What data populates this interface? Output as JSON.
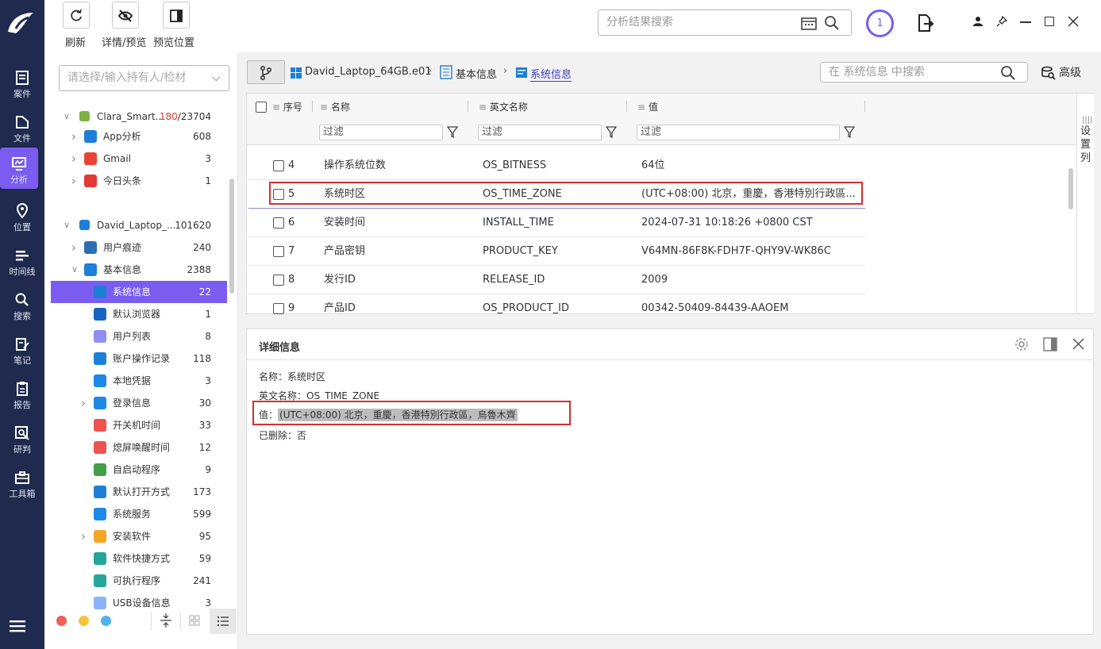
{
  "nav": [
    {
      "label": "案件",
      "icon": "case-icon"
    },
    {
      "label": "文件",
      "icon": "file-icon"
    },
    {
      "label": "分析",
      "icon": "analysis-icon"
    },
    {
      "label": "位置",
      "icon": "location-icon"
    },
    {
      "label": "时间线",
      "icon": "timeline-icon"
    },
    {
      "label": "搜索",
      "icon": "search-icon"
    },
    {
      "label": "笔记",
      "icon": "note-icon"
    },
    {
      "label": "报告",
      "icon": "report-icon"
    },
    {
      "label": "研判",
      "icon": "judge-icon"
    },
    {
      "label": "工具箱",
      "icon": "toolbox-icon"
    }
  ],
  "toolbar": {
    "refresh": "刷新",
    "details_preview": "详情/预览",
    "preview_position": "预览位置"
  },
  "top_search": {
    "placeholder": "分析结果搜索"
  },
  "badge_count": "1",
  "tree_search_placeholder": "请选择/输入持有人/检材",
  "tree": [
    {
      "label": "Clara_Smart...",
      "count_red": "180",
      "count": "/23704",
      "level": 0
    },
    {
      "label": "App分析",
      "count": "608",
      "level": 1
    },
    {
      "label": "Gmail",
      "count": "3",
      "level": 1
    },
    {
      "label": "今日头条",
      "count": "1",
      "level": 1
    },
    {
      "label": "David_Laptop_...",
      "count": "101620",
      "level": 0
    },
    {
      "label": "用户痕迹",
      "count": "240",
      "level": 1
    },
    {
      "label": "基本信息",
      "count": "2388",
      "level": 1
    },
    {
      "label": "系统信息",
      "count": "22",
      "level": 2
    },
    {
      "label": "默认浏览器",
      "count": "1",
      "level": 2
    },
    {
      "label": "用户列表",
      "count": "8",
      "level": 2
    },
    {
      "label": "账户操作记录",
      "count": "118",
      "level": 2
    },
    {
      "label": "本地凭据",
      "count": "3",
      "level": 2
    },
    {
      "label": "登录信息",
      "count": "30",
      "level": 2
    },
    {
      "label": "开关机时间",
      "count": "33",
      "level": 2
    },
    {
      "label": "熄屏唤醒时间",
      "count": "12",
      "level": 2
    },
    {
      "label": "自启动程序",
      "count": "9",
      "level": 2
    },
    {
      "label": "默认打开方式",
      "count": "173",
      "level": 2
    },
    {
      "label": "系统服务",
      "count": "599",
      "level": 2
    },
    {
      "label": "安装软件",
      "count": "95",
      "level": 2
    },
    {
      "label": "软件快捷方式",
      "count": "59",
      "level": 2
    },
    {
      "label": "可执行程序",
      "count": "241",
      "level": 2
    },
    {
      "label": "USB设备信息",
      "count": "3",
      "level": 2
    }
  ],
  "breadcrumb": {
    "device": "David_Laptop_64GB.e01",
    "cat": "基本信息",
    "sub": "系统信息"
  },
  "panel_search_placeholder": "在 系统信息 中搜索",
  "advanced": "高级",
  "columns": {
    "seq": "序号",
    "name": "名称",
    "en": "英文名称",
    "val": "值"
  },
  "filter": "过滤",
  "settings_col": [
    "设",
    "置",
    "列"
  ],
  "rows": [
    {
      "seq": "4",
      "name": "操作系统位数",
      "en": "OS_BITNESS",
      "val": "64位"
    },
    {
      "seq": "5",
      "name": "系统时区",
      "en": "OS_TIME_ZONE",
      "val": "(UTC+08:00) 北京，重慶，香港特別行政區..."
    },
    {
      "seq": "6",
      "name": "安装时间",
      "en": "INSTALL_TIME",
      "val": "2024-07-31 10:18:26 +0800 CST"
    },
    {
      "seq": "7",
      "name": "产品密钥",
      "en": "PRODUCT_KEY",
      "val": "V64MN-86F8K-FDH7F-QHY9V-WK86C"
    },
    {
      "seq": "8",
      "name": "发行ID",
      "en": "RELEASE_ID",
      "val": "2009"
    },
    {
      "seq": "9",
      "name": "产品ID",
      "en": "OS_PRODUCT_ID",
      "val": "00342-50409-84439-AAOEM"
    }
  ],
  "detail": {
    "title": "详细信息",
    "name_label": "名称：",
    "name_val": "系统时区",
    "en_label": "英文名称：",
    "en_val": "OS_TIME_ZONE",
    "val_label": "值：",
    "val_val": "(UTC+08:00) 北京，重慶，香港特別行政區，烏魯木齊",
    "del_label": "已删除：",
    "del_val": "否"
  }
}
